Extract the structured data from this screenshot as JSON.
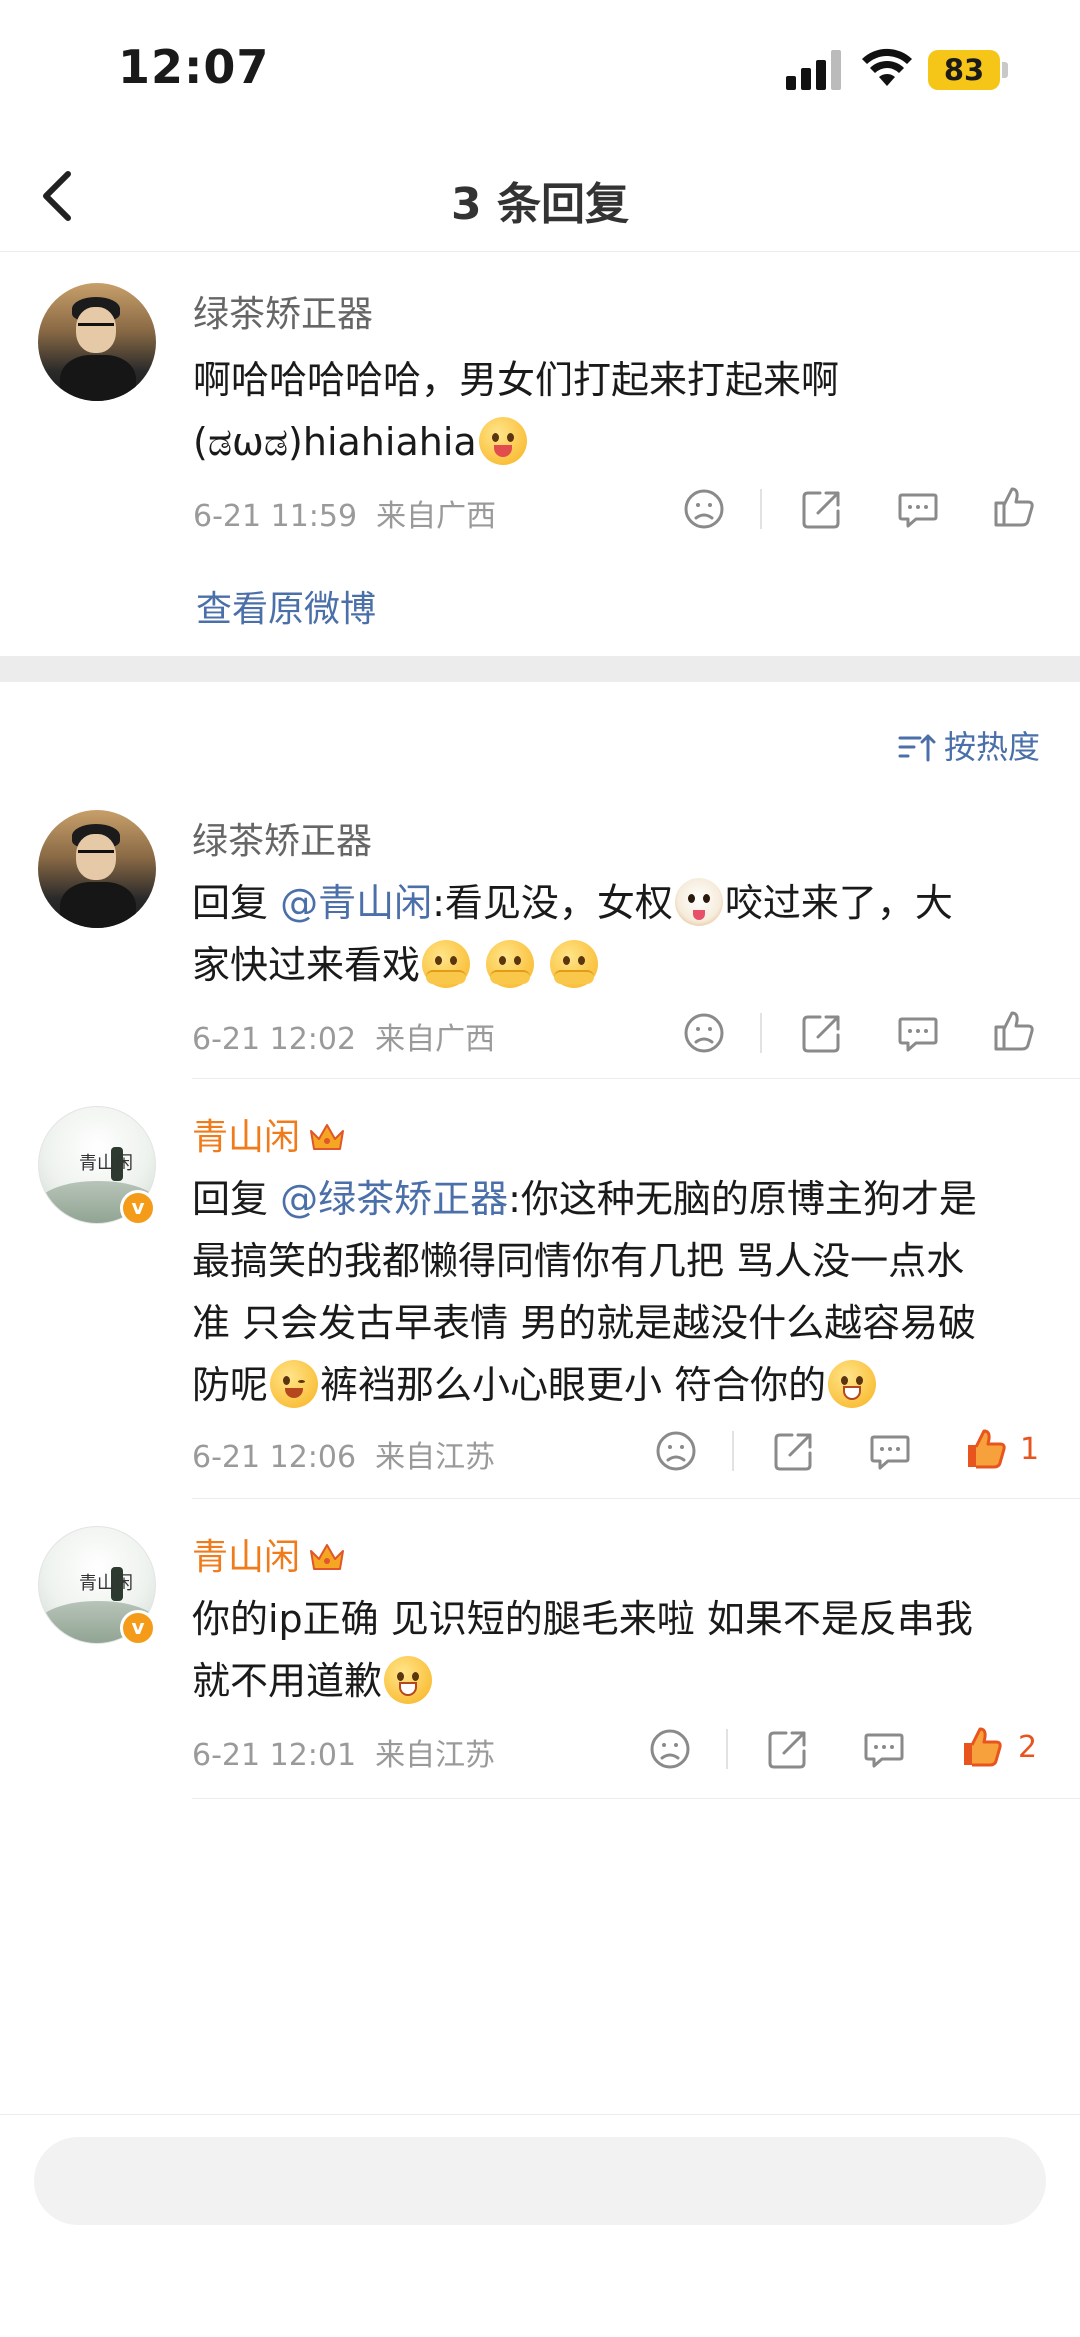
{
  "status_bar": {
    "time": "12:07",
    "battery": "83"
  },
  "nav": {
    "title": "3 条回复"
  },
  "original_comment": {
    "username": "绿茶矫正器",
    "text_line1": "啊哈哈哈哈哈，男女们打起来打起来啊",
    "text_line2": "(ಡωಡ)hiahiahia",
    "date": "6-21 11:59",
    "location": "来自广西",
    "view_original": "查看原微博"
  },
  "sort": {
    "label": "按热度"
  },
  "replies": [
    {
      "username": "绿茶矫正器",
      "prefix": "回复 ",
      "mention": "@青山闲",
      "text_a": ":看见没，女权",
      "text_b": "咬过来了，大",
      "text_line2": "家快过来看戏",
      "date": "6-21 12:02",
      "location": "来自广西",
      "likes": ""
    },
    {
      "username": "青山闲",
      "prefix": "回复 ",
      "mention": "@绿茶矫正器",
      "text_l1": ":你这种无脑的原博主狗才是",
      "text_l2": "最搞笑的我都懒得同情你有几把 骂人没一点水",
      "text_l3": "准 只会发古早表情 男的就是越没什么越容易破",
      "text_l4a": "防呢",
      "text_l4b": "裤裆那么小心眼更小 符合你的",
      "date": "6-21 12:06",
      "location": "来自江苏",
      "likes": "1"
    },
    {
      "username": "青山闲",
      "text_l1": "你的ip正确 见识短的腿毛来啦 如果不是反串我",
      "text_l2": "就不用道歉",
      "date": "6-21 12:01",
      "location": "来自江苏",
      "likes": "2"
    }
  ],
  "avatar_art_text": "青山闲",
  "colors": {
    "link": "#4b6fa8",
    "vip_name": "#f07b1b",
    "liked": "#e8541e",
    "battery": "#f5c518"
  },
  "input": {
    "placeholder": ""
  }
}
